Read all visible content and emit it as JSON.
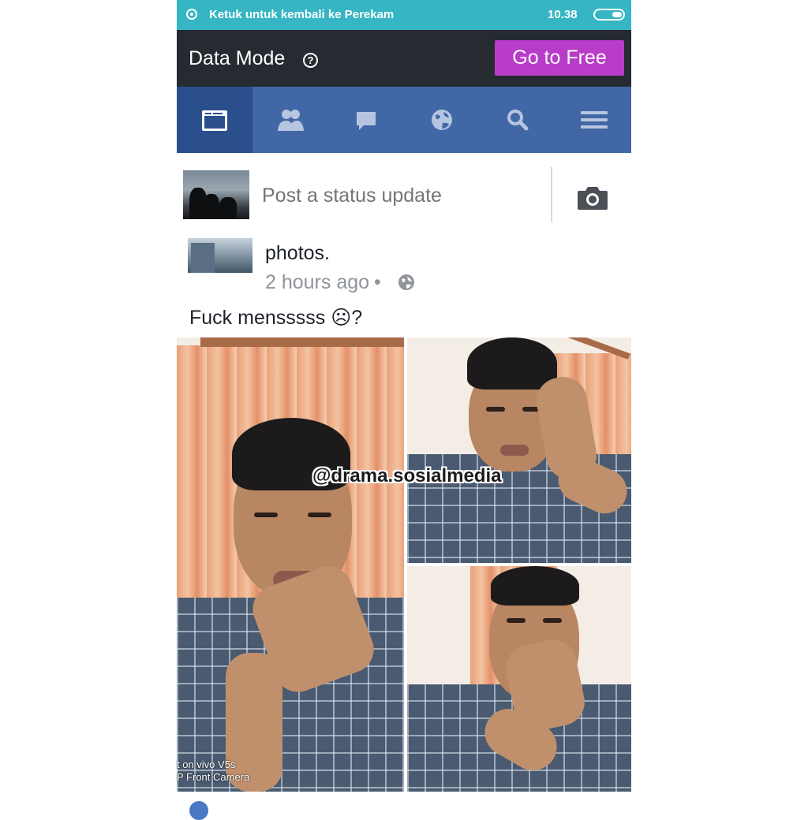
{
  "status_bar": {
    "recording_text": "Ketuk untuk kembali ke Perekam",
    "time": "10.38",
    "icons": [
      "record-icon",
      "battery-icon"
    ]
  },
  "data_bar": {
    "title": "Data Mode",
    "help_glyph": "?",
    "go_free_label": "Go to Free",
    "accent_color": "#b83cc8"
  },
  "nav_tabs": [
    {
      "icon": "news-feed-icon",
      "active": true
    },
    {
      "icon": "friends-icon",
      "active": false
    },
    {
      "icon": "messages-icon",
      "active": false
    },
    {
      "icon": "notifications-globe-icon",
      "active": false
    },
    {
      "icon": "search-icon",
      "active": false
    },
    {
      "icon": "menu-icon",
      "active": false
    }
  ],
  "composer": {
    "placeholder": "Post a status update",
    "camera_icon": "camera-icon"
  },
  "post": {
    "author_tail": "photos.",
    "time": "2 hours ago",
    "separator": "•",
    "audience_icon": "globe-icon",
    "caption": "Fuck mensssss ☹?"
  },
  "overlays": {
    "watermark": "@drama.sosialmedia",
    "shot_on_line1": "t on vivo V5s",
    "shot_on_line2": "P Front Camera"
  },
  "colors": {
    "status_bar": "#36b6c4",
    "data_bar": "#262a31",
    "nav_bar": "#4267a6",
    "nav_active": "#2b4f8c"
  }
}
